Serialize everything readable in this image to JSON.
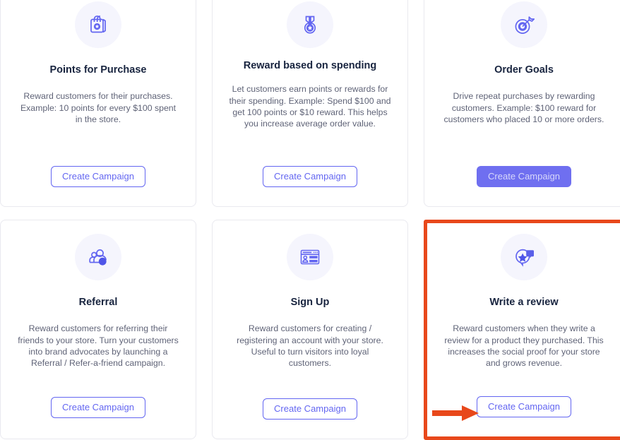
{
  "theme": {
    "accent": "#6366f1",
    "accent_filled": "#6f6ff0",
    "icon_bg": "#f5f5fd",
    "title_color": "#18243f",
    "body_color": "#5f6377",
    "card_border": "#e9e9ef",
    "highlight_border": "#e8481b",
    "arrow_color": "#e8481b",
    "page_bg": "#ffffff"
  },
  "annotation": {
    "arrow_name": "arrow-pointing-to-create-campaign-button",
    "target": "write-a-review-create-campaign-button",
    "highlight_card": "Write a review"
  },
  "cards": [
    {
      "id": "points-for-purchase",
      "icon": "shopping-bag-star-icon",
      "title": "Points for Purchase",
      "description": "Reward customers for their purchases. Example: 10 points for every $100 spent in the store.",
      "button_label": "Create Campaign",
      "button_state": "outlined",
      "highlighted": false
    },
    {
      "id": "reward-based-on-spending",
      "icon": "medal-star-icon",
      "title": "Reward based on spending",
      "description": "Let customers earn points or rewards for their spending. Example: Spend $100 and get 100 points or $10 reward. This helps you increase average order value.",
      "button_label": "Create Campaign",
      "button_state": "outlined",
      "highlighted": false
    },
    {
      "id": "order-goals",
      "icon": "target-dart-icon",
      "title": "Order Goals",
      "description": "Drive repeat purchases by rewarding customers. Example: $100 reward for customers who placed 10 or more orders.",
      "button_label": "Create Campaign",
      "button_state": "filled",
      "highlighted": false
    },
    {
      "id": "referral",
      "icon": "users-referral-icon",
      "title": "Referral",
      "description": "Reward customers for referring their friends to your store. Turn your customers into brand advocates by launching a Referral / Refer-a-friend campaign.",
      "button_label": "Create Campaign",
      "button_state": "outlined",
      "highlighted": false
    },
    {
      "id": "sign-up",
      "icon": "browser-signup-form-icon",
      "title": "Sign Up",
      "description": "Reward customers for creating / registering an account with your store. Useful to turn visitors into loyal customers.",
      "button_label": "Create Campaign",
      "button_state": "outlined",
      "highlighted": false
    },
    {
      "id": "write-a-review",
      "icon": "review-bubble-star-icon",
      "title": "Write a review",
      "description": "Reward customers when they write a review for a product they purchased. This increases the social proof for your store and grows revenue.",
      "button_label": "Create Campaign",
      "button_state": "outlined",
      "highlighted": true
    }
  ]
}
